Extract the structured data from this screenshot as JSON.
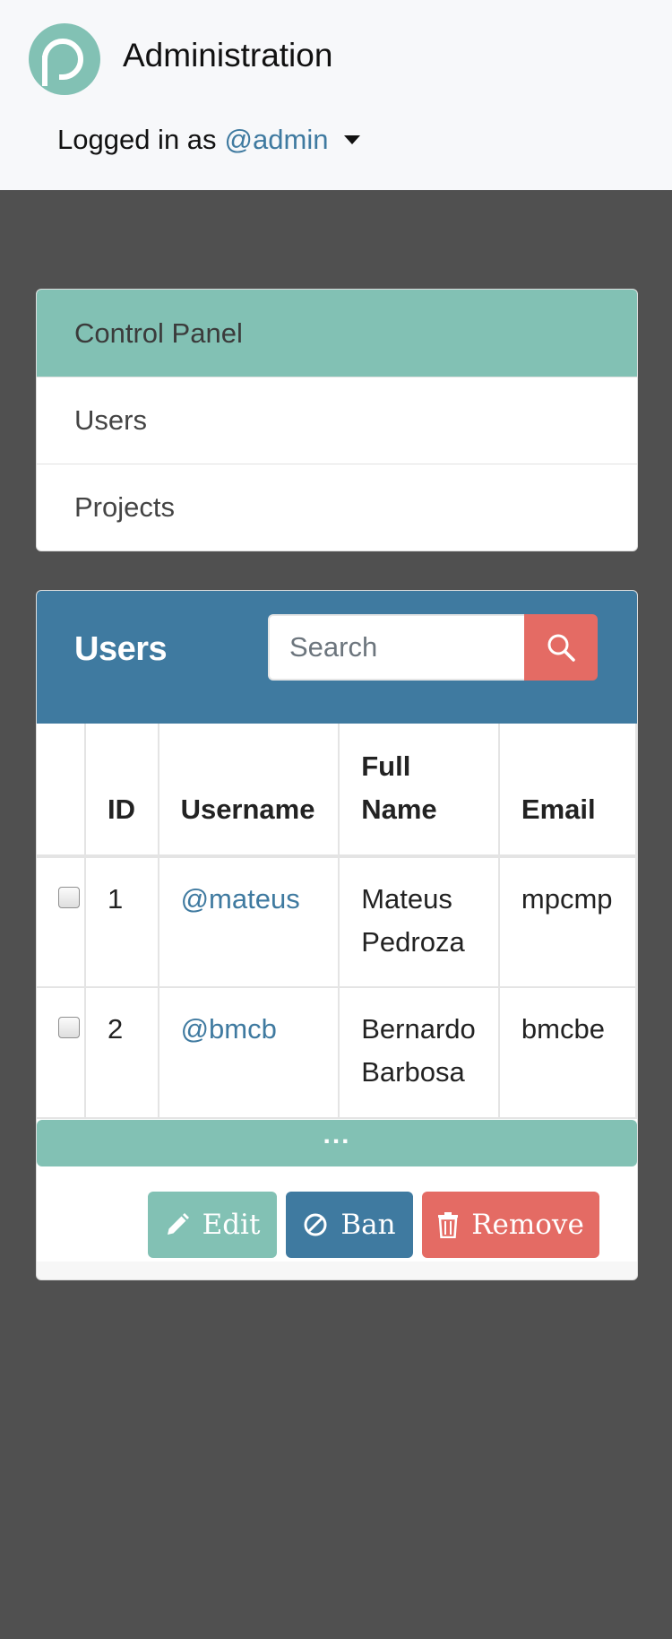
{
  "header": {
    "title": "Administration",
    "logged_in_prefix": "Logged in as",
    "username": "@admin"
  },
  "nav": {
    "items": [
      {
        "label": "Control Panel",
        "active": true
      },
      {
        "label": "Users",
        "active": false
      },
      {
        "label": "Projects",
        "active": false
      }
    ]
  },
  "users_panel": {
    "title": "Users",
    "search_placeholder": "Search",
    "columns": [
      "",
      "ID",
      "Username",
      "Full Name",
      "Email"
    ],
    "rows": [
      {
        "id": "1",
        "username": "@mateus",
        "full_name_1": "Mateus",
        "full_name_2": "Pedroza",
        "email": "mpcmp"
      },
      {
        "id": "2",
        "username": "@bmcb",
        "full_name_1": "Bernardo",
        "full_name_2": "Barbosa",
        "email": "bmcbe"
      }
    ],
    "more_label": "...",
    "actions": {
      "edit": "Edit",
      "ban": "Ban",
      "remove": "Remove"
    }
  },
  "colors": {
    "teal": "#82c1b4",
    "blue": "#3f7aa0",
    "red": "#e46b64",
    "background": "#505050"
  }
}
